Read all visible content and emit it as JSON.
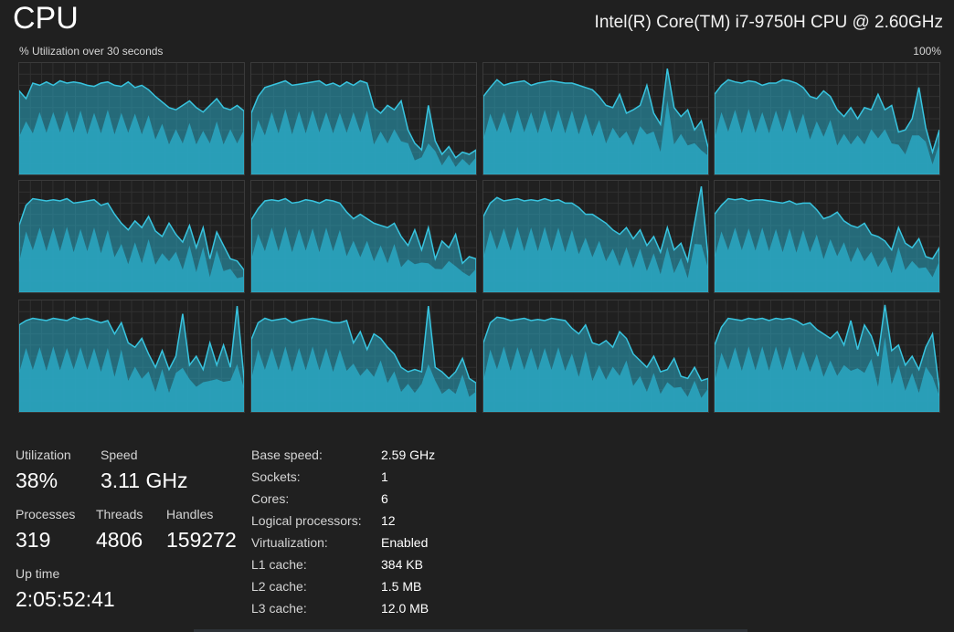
{
  "header": {
    "title": "CPU",
    "cpu_model": "Intel(R) Core(TM) i7-9750H CPU @ 2.60GHz",
    "utilization_caption": "% Utilization over 30 seconds",
    "utilization_max": "100%"
  },
  "colors": {
    "background": "#202020",
    "graph_fill": "#2aa7c2",
    "graph_line": "#38c4df",
    "graph_kernel": "#1f8aa3",
    "grid_line": "#303030",
    "border": "#3a3a3a"
  },
  "stats": {
    "utilization": {
      "label": "Utilization",
      "value": "38%"
    },
    "speed": {
      "label": "Speed",
      "value": "3.11 GHz"
    },
    "processes": {
      "label": "Processes",
      "value": "319"
    },
    "threads": {
      "label": "Threads",
      "value": "4806"
    },
    "handles": {
      "label": "Handles",
      "value": "159272"
    },
    "uptime": {
      "label": "Up time",
      "value": "2:05:52:41"
    }
  },
  "specs": [
    {
      "label": "Base speed:",
      "value": "2.59 GHz"
    },
    {
      "label": "Sockets:",
      "value": "1"
    },
    {
      "label": "Cores:",
      "value": "6"
    },
    {
      "label": "Logical processors:",
      "value": "12"
    },
    {
      "label": "Virtualization:",
      "value": "Enabled"
    },
    {
      "label": "L1 cache:",
      "value": "384 KB"
    },
    {
      "label": "L2 cache:",
      "value": "1.5 MB"
    },
    {
      "label": "L3 cache:",
      "value": "12.0 MB"
    }
  ],
  "chart_data": {
    "type": "area",
    "title": "% Utilization over 30 seconds",
    "ylim": [
      0,
      100
    ],
    "grid": true,
    "series": [
      {
        "values": [
          75,
          68,
          82,
          80,
          83,
          80,
          84,
          82,
          83,
          82,
          80,
          79,
          82,
          83,
          80,
          79,
          83,
          78,
          80,
          76,
          70,
          65,
          60,
          58,
          62,
          66,
          60,
          56,
          62,
          68,
          60,
          58,
          62,
          57
        ]
      },
      {
        "values": [
          55,
          70,
          78,
          80,
          82,
          84,
          80,
          81,
          82,
          83,
          84,
          80,
          82,
          79,
          83,
          80,
          84,
          82,
          60,
          55,
          62,
          58,
          66,
          40,
          28,
          22,
          62,
          30,
          18,
          25,
          15,
          20,
          18,
          22
        ]
      },
      {
        "values": [
          70,
          78,
          85,
          80,
          82,
          83,
          84,
          80,
          82,
          83,
          84,
          83,
          82,
          82,
          80,
          78,
          76,
          70,
          62,
          60,
          72,
          55,
          58,
          62,
          80,
          55,
          45,
          95,
          60,
          52,
          58,
          40,
          48,
          24
        ]
      },
      {
        "values": [
          72,
          80,
          85,
          83,
          82,
          84,
          83,
          80,
          82,
          82,
          85,
          84,
          82,
          78,
          70,
          68,
          75,
          70,
          58,
          52,
          60,
          50,
          60,
          58,
          72,
          58,
          62,
          38,
          40,
          50,
          78,
          42,
          20,
          40
        ]
      },
      {
        "values": [
          60,
          78,
          84,
          83,
          82,
          83,
          82,
          84,
          80,
          81,
          82,
          83,
          78,
          80,
          70,
          62,
          56,
          64,
          58,
          68,
          55,
          50,
          62,
          52,
          45,
          60,
          40,
          58,
          30,
          54,
          42,
          30,
          28,
          20
        ]
      },
      {
        "values": [
          65,
          75,
          82,
          83,
          82,
          84,
          80,
          81,
          83,
          82,
          80,
          83,
          82,
          80,
          72,
          66,
          70,
          66,
          62,
          60,
          58,
          62,
          50,
          42,
          56,
          38,
          58,
          30,
          46,
          40,
          52,
          26,
          32,
          30
        ]
      },
      {
        "values": [
          68,
          80,
          85,
          82,
          83,
          84,
          82,
          83,
          82,
          84,
          82,
          83,
          80,
          80,
          76,
          70,
          70,
          66,
          62,
          56,
          52,
          58,
          48,
          56,
          42,
          50,
          36,
          58,
          38,
          44,
          28,
          62,
          95,
          30
        ]
      },
      {
        "values": [
          70,
          78,
          84,
          83,
          84,
          82,
          83,
          83,
          82,
          81,
          80,
          82,
          79,
          80,
          80,
          74,
          66,
          68,
          72,
          64,
          60,
          58,
          62,
          52,
          50,
          46,
          38,
          58,
          44,
          40,
          48,
          32,
          30,
          40
        ]
      },
      {
        "values": [
          78,
          82,
          84,
          83,
          82,
          84,
          83,
          82,
          85,
          83,
          84,
          82,
          80,
          82,
          70,
          80,
          62,
          58,
          66,
          52,
          40,
          55,
          38,
          50,
          88,
          42,
          50,
          38,
          62,
          42,
          60,
          40,
          95,
          30
        ]
      },
      {
        "values": [
          65,
          80,
          84,
          82,
          83,
          84,
          80,
          82,
          83,
          84,
          83,
          82,
          80,
          80,
          82,
          62,
          72,
          56,
          70,
          66,
          58,
          52,
          40,
          36,
          38,
          36,
          95,
          40,
          36,
          30,
          36,
          48,
          30,
          26
        ]
      },
      {
        "values": [
          62,
          80,
          85,
          84,
          82,
          83,
          84,
          82,
          83,
          82,
          84,
          83,
          82,
          75,
          70,
          78,
          62,
          60,
          64,
          58,
          72,
          66,
          52,
          46,
          40,
          50,
          36,
          38,
          48,
          32,
          30,
          40,
          28,
          30
        ]
      },
      {
        "values": [
          60,
          76,
          84,
          83,
          82,
          84,
          83,
          84,
          82,
          84,
          83,
          84,
          82,
          78,
          80,
          74,
          70,
          66,
          72,
          60,
          82,
          56,
          78,
          68,
          50,
          96,
          55,
          60,
          42,
          50,
          38,
          58,
          70,
          20
        ]
      }
    ]
  }
}
